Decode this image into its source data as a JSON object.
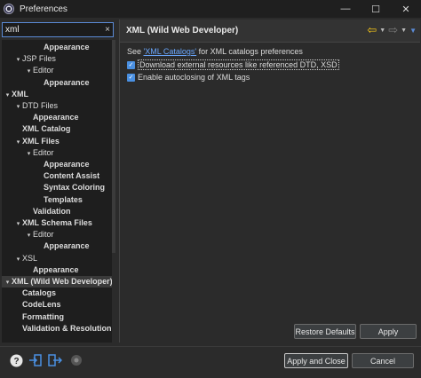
{
  "window": {
    "title": "Preferences",
    "minimize_glyph": "—",
    "maximize_glyph": "☐",
    "close_glyph": "✕"
  },
  "search": {
    "value": "xml",
    "clear_glyph": "×"
  },
  "tree": [
    {
      "label": "Appearance",
      "indent": 3,
      "twisty": "",
      "bold": true
    },
    {
      "label": "JSP Files",
      "indent": 1,
      "twisty": "▾",
      "bold": false
    },
    {
      "label": "Editor",
      "indent": 2,
      "twisty": "▾",
      "bold": false
    },
    {
      "label": "Appearance",
      "indent": 3,
      "twisty": "",
      "bold": true
    },
    {
      "label": "XML",
      "indent": 0,
      "twisty": "▾",
      "bold": true
    },
    {
      "label": "DTD Files",
      "indent": 1,
      "twisty": "▾",
      "bold": false
    },
    {
      "label": "Appearance",
      "indent": 2,
      "twisty": "",
      "bold": true
    },
    {
      "label": "XML Catalog",
      "indent": 1,
      "twisty": "",
      "bold": true
    },
    {
      "label": "XML Files",
      "indent": 1,
      "twisty": "▾",
      "bold": true
    },
    {
      "label": "Editor",
      "indent": 2,
      "twisty": "▾",
      "bold": false
    },
    {
      "label": "Appearance",
      "indent": 3,
      "twisty": "",
      "bold": true
    },
    {
      "label": "Content Assist",
      "indent": 3,
      "twisty": "",
      "bold": true
    },
    {
      "label": "Syntax Coloring",
      "indent": 3,
      "twisty": "",
      "bold": true
    },
    {
      "label": "Templates",
      "indent": 3,
      "twisty": "",
      "bold": true
    },
    {
      "label": "Validation",
      "indent": 2,
      "twisty": "",
      "bold": true
    },
    {
      "label": "XML Schema Files",
      "indent": 1,
      "twisty": "▾",
      "bold": true
    },
    {
      "label": "Editor",
      "indent": 2,
      "twisty": "▾",
      "bold": false
    },
    {
      "label": "Appearance",
      "indent": 3,
      "twisty": "",
      "bold": true
    },
    {
      "label": "XSL",
      "indent": 1,
      "twisty": "▾",
      "bold": false
    },
    {
      "label": "Appearance",
      "indent": 2,
      "twisty": "",
      "bold": true
    },
    {
      "label": "XML (Wild Web Developer)",
      "indent": 0,
      "twisty": "▾",
      "bold": true,
      "selected": true
    },
    {
      "label": "Catalogs",
      "indent": 1,
      "twisty": "",
      "bold": true
    },
    {
      "label": "CodeLens",
      "indent": 1,
      "twisty": "",
      "bold": true
    },
    {
      "label": "Formatting",
      "indent": 1,
      "twisty": "",
      "bold": true
    },
    {
      "label": "Validation & Resolution",
      "indent": 1,
      "twisty": "",
      "bold": true
    }
  ],
  "page": {
    "title": "XML (Wild Web Developer)",
    "see_prefix": "See ",
    "see_link": "'XML Catalogs'",
    "see_suffix": " for XML catalogs preferences",
    "checkbox1": {
      "label": "Download external resources like referenced DTD, XSD",
      "checked": true
    },
    "checkbox2": {
      "label": "Enable autoclosing of XML tags",
      "checked": true
    },
    "restore_defaults": "Restore Defaults",
    "apply": "Apply"
  },
  "footer": {
    "help_icon": "help-icon",
    "import_icon": "import-icon",
    "export_icon": "export-icon",
    "apply_close": "Apply and Close",
    "cancel": "Cancel"
  },
  "colors": {
    "accent": "#4a90e2",
    "link": "#6aa8ff",
    "back_arrow": "#f5c518",
    "background": "#2b2b2b"
  }
}
